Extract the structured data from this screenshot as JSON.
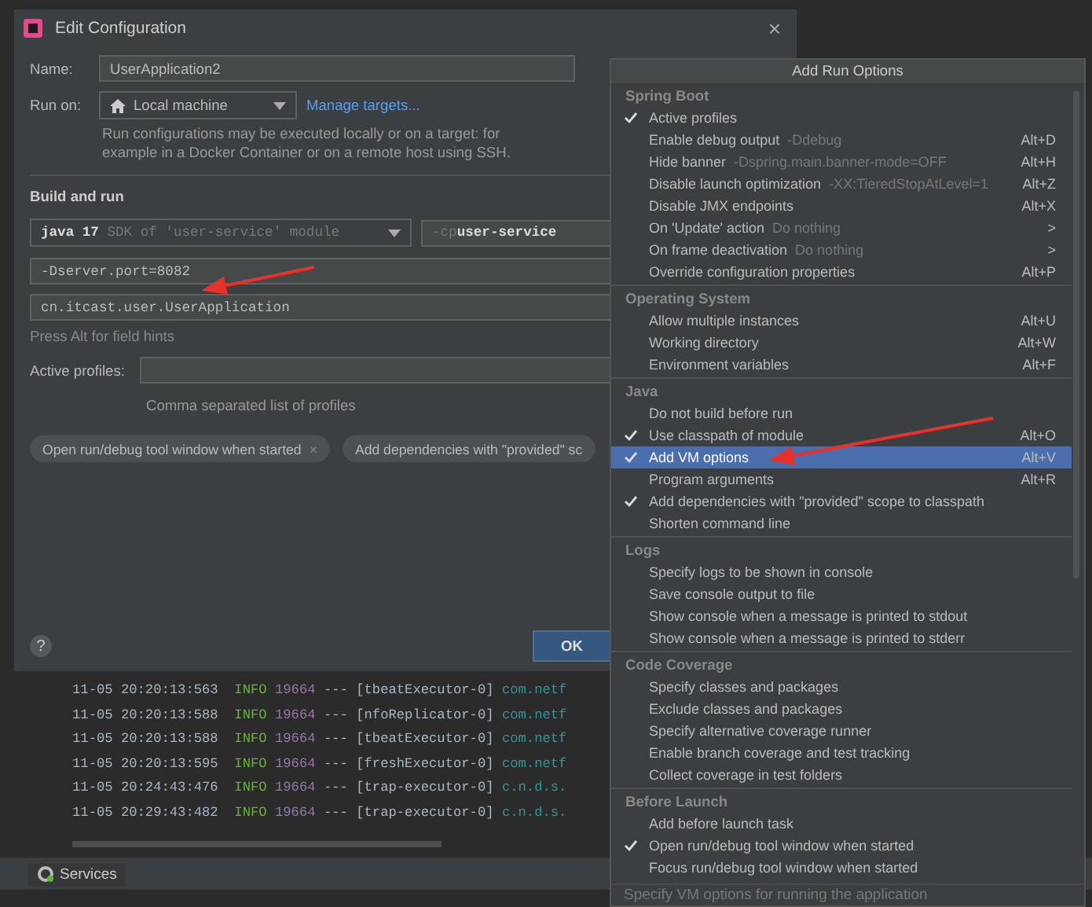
{
  "dialog": {
    "title": "Edit Configuration",
    "close": "×",
    "name": {
      "label": "Name:",
      "value": "UserApplication2"
    },
    "run_on": {
      "label": "Run on:",
      "value": "Local machine",
      "link": "Manage targets...",
      "description": "Run configurations may be executed locally or on a target: for example in a Docker Container or on a remote host using SSH."
    },
    "section": "Build and run",
    "jre": {
      "strong": "java 17",
      "muted": "SDK of 'user-service' module"
    },
    "classpath": {
      "flag": "-cp",
      "value": "user-service"
    },
    "vm_options": "-Dserver.port=8082",
    "main_class": "cn.itcast.user.UserApplication",
    "hint": "Press Alt for field hints",
    "active_profiles": {
      "label": "Active profiles:",
      "helper": "Comma separated list of profiles"
    },
    "chips": [
      {
        "label": "Open run/debug tool window when started",
        "close": "×"
      },
      {
        "label": "Add dependencies with \"provided\" sc"
      }
    ],
    "help": "?",
    "ok": "OK"
  },
  "console": {
    "lines": [
      {
        "time": "11-05 20:20:13:563",
        "level": "INFO",
        "pid": "19664",
        "sep": "---",
        "thread": "[tbeatExecutor-0]",
        "logger": "com.netf"
      },
      {
        "time": "11-05 20:20:13:588",
        "level": "INFO",
        "pid": "19664",
        "sep": "---",
        "thread": "[nfoReplicator-0]",
        "logger": "com.netf"
      },
      {
        "time": "11-05 20:20:13:588",
        "level": "INFO",
        "pid": "19664",
        "sep": "---",
        "thread": "[tbeatExecutor-0]",
        "logger": "com.netf"
      },
      {
        "time": "11-05 20:20:13:595",
        "level": "INFO",
        "pid": "19664",
        "sep": "---",
        "thread": "[freshExecutor-0]",
        "logger": "com.netf"
      },
      {
        "time": "11-05 20:24:43:476",
        "level": "INFO",
        "pid": "19664",
        "sep": "---",
        "thread": "[trap-executor-0]",
        "logger": "c.n.d.s."
      },
      {
        "time": "11-05 20:29:43:482",
        "level": "INFO",
        "pid": "19664",
        "sep": "---",
        "thread": "[trap-executor-0]",
        "logger": "c.n.d.s."
      }
    ]
  },
  "tool_tab": "Services",
  "popup": {
    "title": "Add Run Options",
    "sections": [
      {
        "title": "Spring Boot",
        "items": [
          {
            "label": "Active profiles",
            "checked": true,
            "selected": false
          },
          {
            "label": "Enable debug output",
            "hint": "-Ddebug",
            "shortcut": "Alt+D",
            "checked": false,
            "selected": false
          },
          {
            "label": "Hide banner",
            "hint": "-Dspring.main.banner-mode=OFF",
            "shortcut": "Alt+H",
            "checked": false,
            "selected": false
          },
          {
            "label": "Disable launch optimization",
            "hint": "-XX:TieredStopAtLevel=1",
            "shortcut": "Alt+Z",
            "checked": false,
            "selected": false
          },
          {
            "label": "Disable JMX endpoints",
            "shortcut": "Alt+X",
            "checked": false,
            "selected": false
          },
          {
            "label": "On 'Update' action",
            "hint": "Do nothing",
            "shortcut": ">",
            "checked": false,
            "selected": false
          },
          {
            "label": "On frame deactivation",
            "hint": "Do nothing",
            "shortcut": ">",
            "checked": false,
            "selected": false
          },
          {
            "label": "Override configuration properties",
            "shortcut": "Alt+P",
            "checked": false,
            "selected": false
          }
        ]
      },
      {
        "title": "Operating System",
        "items": [
          {
            "label": "Allow multiple instances",
            "shortcut": "Alt+U",
            "checked": false,
            "selected": false
          },
          {
            "label": "Working directory",
            "shortcut": "Alt+W",
            "checked": false,
            "selected": false
          },
          {
            "label": "Environment variables",
            "shortcut": "Alt+F",
            "checked": false,
            "selected": false
          }
        ]
      },
      {
        "title": "Java",
        "items": [
          {
            "label": "Do not build before run",
            "checked": false,
            "selected": false
          },
          {
            "label": "Use classpath of module",
            "shortcut": "Alt+O",
            "checked": true,
            "selected": false
          },
          {
            "label": "Add VM options",
            "shortcut": "Alt+V",
            "checked": true,
            "selected": true
          },
          {
            "label": "Program arguments",
            "shortcut": "Alt+R",
            "checked": false,
            "selected": false
          },
          {
            "label": "Add dependencies with \"provided\" scope to classpath",
            "checked": true,
            "selected": false
          },
          {
            "label": "Shorten command line",
            "checked": false,
            "selected": false
          }
        ]
      },
      {
        "title": "Logs",
        "items": [
          {
            "label": "Specify logs to be shown in console",
            "checked": false,
            "selected": false
          },
          {
            "label": "Save console output to file",
            "checked": false,
            "selected": false
          },
          {
            "label": "Show console when a message is printed to stdout",
            "checked": false,
            "selected": false
          },
          {
            "label": "Show console when a message is printed to stderr",
            "checked": false,
            "selected": false
          }
        ]
      },
      {
        "title": "Code Coverage",
        "items": [
          {
            "label": "Specify classes and packages",
            "checked": false,
            "selected": false
          },
          {
            "label": "Exclude classes and packages",
            "checked": false,
            "selected": false
          },
          {
            "label": "Specify alternative coverage runner",
            "checked": false,
            "selected": false
          },
          {
            "label": "Enable branch coverage and test tracking",
            "checked": false,
            "selected": false
          },
          {
            "label": "Collect coverage in test folders",
            "checked": false,
            "selected": false
          }
        ]
      },
      {
        "title": "Before Launch",
        "items": [
          {
            "label": "Add before launch task",
            "checked": false,
            "selected": false
          },
          {
            "label": "Open run/debug tool window when started",
            "checked": true,
            "selected": false
          },
          {
            "label": "Focus run/debug tool window when started",
            "checked": false,
            "selected": false
          }
        ]
      }
    ],
    "status": "Specify VM options for running the application"
  }
}
